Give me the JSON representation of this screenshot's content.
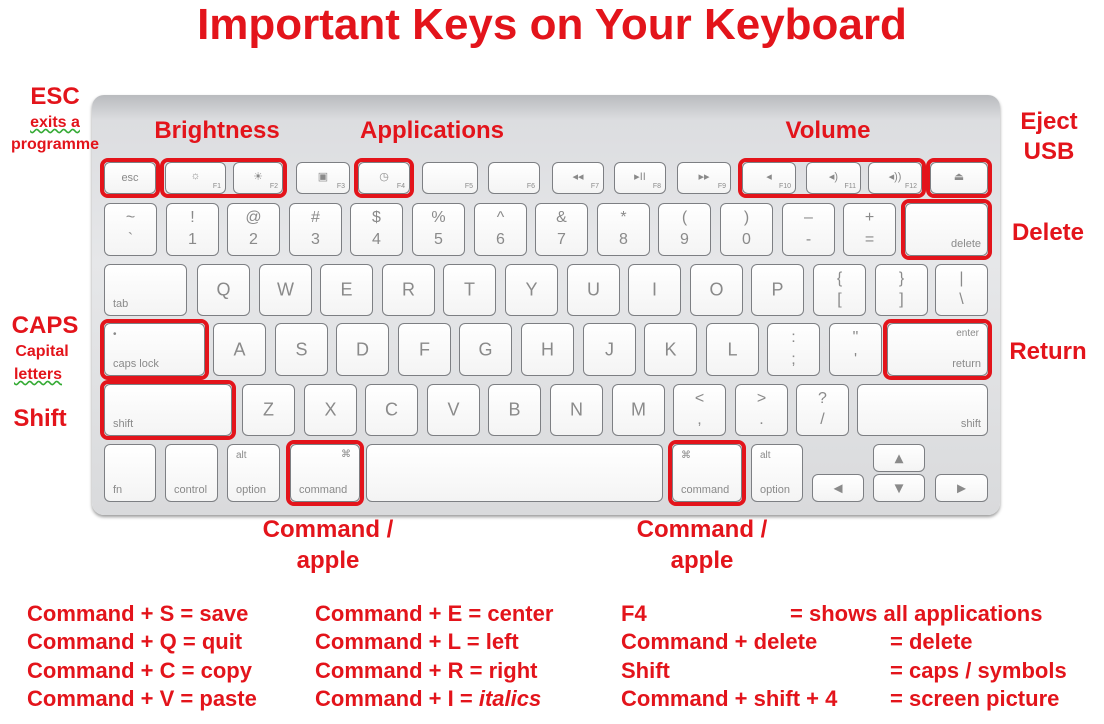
{
  "title": "Important Keys on Your Keyboard",
  "labels": {
    "esc": "ESC",
    "esc_desc1": "exits a",
    "esc_desc2": "programme",
    "brightness": "Brightness",
    "applications": "Applications",
    "volume": "Volume",
    "eject1": "Eject",
    "eject2": "USB",
    "delete": "Delete",
    "caps": "CAPS",
    "caps_desc1": "Capital",
    "caps_desc2": "letters",
    "shift": "Shift",
    "return": "Return",
    "command1": "Command /",
    "command2": "apple"
  },
  "accent_color": "#e3141b",
  "keyboard": {
    "frow": [
      {
        "c": "esc"
      },
      {
        "i": "☼",
        "f": "F1"
      },
      {
        "i": "☀",
        "f": "F2"
      },
      {
        "i": "▣",
        "f": "F3"
      },
      {
        "i": "◷",
        "f": "F4"
      },
      {
        "f": "F5"
      },
      {
        "f": "F6"
      },
      {
        "i": "◂◂",
        "f": "F7"
      },
      {
        "i": "▸II",
        "f": "F8"
      },
      {
        "i": "▸▸",
        "f": "F9"
      },
      {
        "i": "◂",
        "f": "F10"
      },
      {
        "i": "◂)",
        "f": "F11"
      },
      {
        "i": "◂))",
        "f": "F12"
      },
      {
        "i": "⏏"
      }
    ],
    "numrow": [
      {
        "t": "~",
        "b": "`"
      },
      {
        "t": "!",
        "b": "1"
      },
      {
        "t": "@",
        "b": "2"
      },
      {
        "t": "#",
        "b": "3"
      },
      {
        "t": "$",
        "b": "4"
      },
      {
        "t": "%",
        "b": "5"
      },
      {
        "t": "^",
        "b": "6"
      },
      {
        "t": "&",
        "b": "7"
      },
      {
        "t": "*",
        "b": "8"
      },
      {
        "t": "(",
        "b": "9"
      },
      {
        "t": ")",
        "b": "0"
      },
      {
        "t": "–",
        "b": "-"
      },
      {
        "t": "+",
        "b": "="
      },
      {
        "br": "delete"
      }
    ],
    "qrow": [
      {
        "bl": "tab"
      },
      {
        "c": "Q"
      },
      {
        "c": "W"
      },
      {
        "c": "E"
      },
      {
        "c": "R"
      },
      {
        "c": "T"
      },
      {
        "c": "Y"
      },
      {
        "c": "U"
      },
      {
        "c": "I"
      },
      {
        "c": "O"
      },
      {
        "c": "P"
      },
      {
        "t": "{",
        "b": "["
      },
      {
        "t": "}",
        "b": "]"
      },
      {
        "t": "|",
        "b": "\\"
      }
    ],
    "arow": [
      {
        "tl": "•",
        "bl": "caps lock"
      },
      {
        "c": "A"
      },
      {
        "c": "S"
      },
      {
        "c": "D"
      },
      {
        "c": "F"
      },
      {
        "c": "G"
      },
      {
        "c": "H"
      },
      {
        "c": "J"
      },
      {
        "c": "K"
      },
      {
        "c": "L"
      },
      {
        "t": ":",
        "b": ";"
      },
      {
        "t": "\"",
        "b": "'"
      },
      {
        "tr": "enter",
        "br": "return"
      }
    ],
    "zrow": [
      {
        "bl": "shift"
      },
      {
        "c": "Z"
      },
      {
        "c": "X"
      },
      {
        "c": "C"
      },
      {
        "c": "V"
      },
      {
        "c": "B"
      },
      {
        "c": "N"
      },
      {
        "c": "M"
      },
      {
        "t": "<",
        "b": ","
      },
      {
        "t": ">",
        "b": "."
      },
      {
        "t": "?",
        "b": "/"
      },
      {
        "br": "shift"
      }
    ],
    "bottom": [
      {
        "bl": "fn"
      },
      {
        "bl": "control"
      },
      {
        "tl": "alt",
        "bl": "option"
      },
      {
        "tr": "⌘",
        "bl": "command"
      },
      {},
      {
        "tl": "⌘",
        "bl": "command"
      },
      {
        "tl": "alt",
        "bl": "option"
      },
      {
        "c": "◂"
      },
      {
        "c": "▴"
      },
      {
        "c": "▾"
      },
      {
        "c": "▸"
      }
    ]
  },
  "shortcuts": [
    [
      "Command + S = save",
      "Command + Q = quit",
      "Command + C = copy",
      "Command + V = paste"
    ],
    [
      "Command + E = center",
      "Command + L = left",
      "Command + R = right",
      "Command + I  = "
    ],
    [
      "F4",
      "Command + delete",
      "Shift",
      "Command + shift + 4"
    ],
    [
      "= shows all applications",
      "= delete",
      "= caps / symbols",
      "= screen picture"
    ]
  ],
  "italics_word": "italics"
}
